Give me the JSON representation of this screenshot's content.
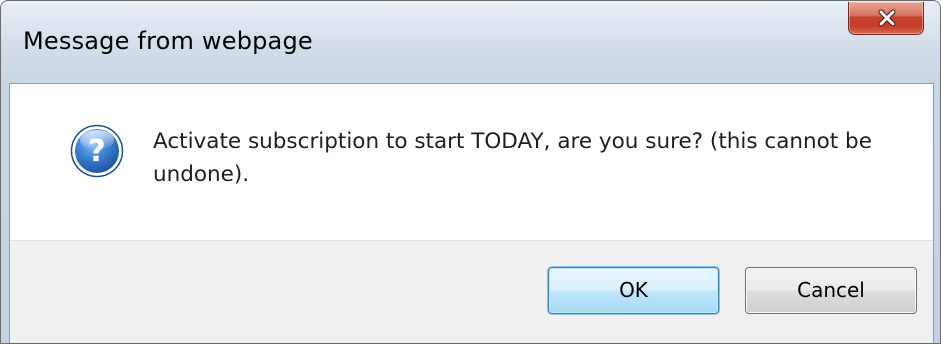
{
  "window": {
    "title": "Message from webpage",
    "close_icon": "close-icon"
  },
  "dialog": {
    "icon": "question-icon",
    "message": "Activate subscription to start TODAY, are you sure? (this cannot be undone)."
  },
  "buttons": {
    "ok_label": "OK",
    "cancel_label": "Cancel"
  },
  "colors": {
    "close_button": "#c73c27",
    "ok_button_border": "#3c7fb1",
    "icon_blue": "#2f6fc0",
    "footer_bg": "#f0f0f0"
  }
}
